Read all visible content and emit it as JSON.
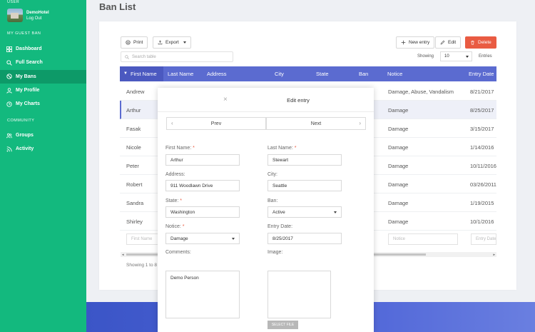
{
  "sidebar": {
    "user_section": "USER",
    "user_name": "DemoHotel",
    "logout": "Log Out",
    "guest_section": "MY GUEST BAN",
    "items": [
      {
        "label": "Dashboard",
        "icon": "grid-icon"
      },
      {
        "label": "Full Search",
        "icon": "search-icon"
      },
      {
        "label": "My Bans",
        "icon": "ban-icon",
        "active": true
      },
      {
        "label": "My Profile",
        "icon": "user-icon"
      },
      {
        "label": "My Charts",
        "icon": "clock-icon"
      }
    ],
    "community_section": "COMMUNITY",
    "community_items": [
      {
        "label": "Groups",
        "icon": "users-icon"
      },
      {
        "label": "Activity",
        "icon": "rss-icon"
      }
    ]
  },
  "page": {
    "title": "Ban List"
  },
  "toolbar": {
    "print": "Print",
    "export": "Export",
    "new_entry": "New entry",
    "edit": "Edit",
    "delete": "Delete",
    "search_placeholder": "Search table",
    "showing_label": "Showing",
    "page_size": "10",
    "entries_label": "Entries"
  },
  "table": {
    "columns": [
      "First Name",
      "Last Name",
      "Address",
      "City",
      "State",
      "Ban",
      "Notice",
      "Entry Date"
    ],
    "rows": [
      {
        "first": "Andrew",
        "notice": "Damage, Abuse, Vandalism",
        "date": "8/21/2017"
      },
      {
        "first": "Arthur",
        "notice": "Damage",
        "date": "8/25/2017"
      },
      {
        "first": "Fasak",
        "notice": "Damage",
        "date": "3/15/2017"
      },
      {
        "first": "Nicole",
        "notice": "Damage",
        "date": "1/14/2016"
      },
      {
        "first": "Peter",
        "notice": "Damage",
        "date": "10/11/2016"
      },
      {
        "first": "Robert",
        "notice": "Damage",
        "date": "03/26/2011"
      },
      {
        "first": "Sandra",
        "notice": "Damage",
        "date": "1/19/2015"
      },
      {
        "first": "Shirley",
        "notice": "Damage",
        "date": "10/1/2016"
      }
    ],
    "filter_first": "First Name",
    "filter_notice": "Notice",
    "filter_date": "Entry Date",
    "footer": "Showing 1 to 8"
  },
  "modal": {
    "close": "×",
    "title": "Edit entry",
    "prev": "Prev",
    "next": "Next",
    "first_name_label": "First Name:",
    "first_name": "Arthur",
    "last_name_label": "Last Name:",
    "last_name": "Stewart",
    "address_label": "Address:",
    "address": "911 Woodlawn Drive",
    "city_label": "City:",
    "city": "Seattle",
    "state_label": "State:",
    "state": "Washington",
    "ban_label": "Ban:",
    "ban": "Active",
    "notice_label": "Notice:",
    "notice": "Damage",
    "entry_date_label": "Entry Date:",
    "entry_date": "8/25/2017",
    "comments_label": "Comments:",
    "comments": "Demo Person",
    "image_label": "Image:",
    "select_file": "SELECT FILE",
    "required_mark": "*"
  }
}
